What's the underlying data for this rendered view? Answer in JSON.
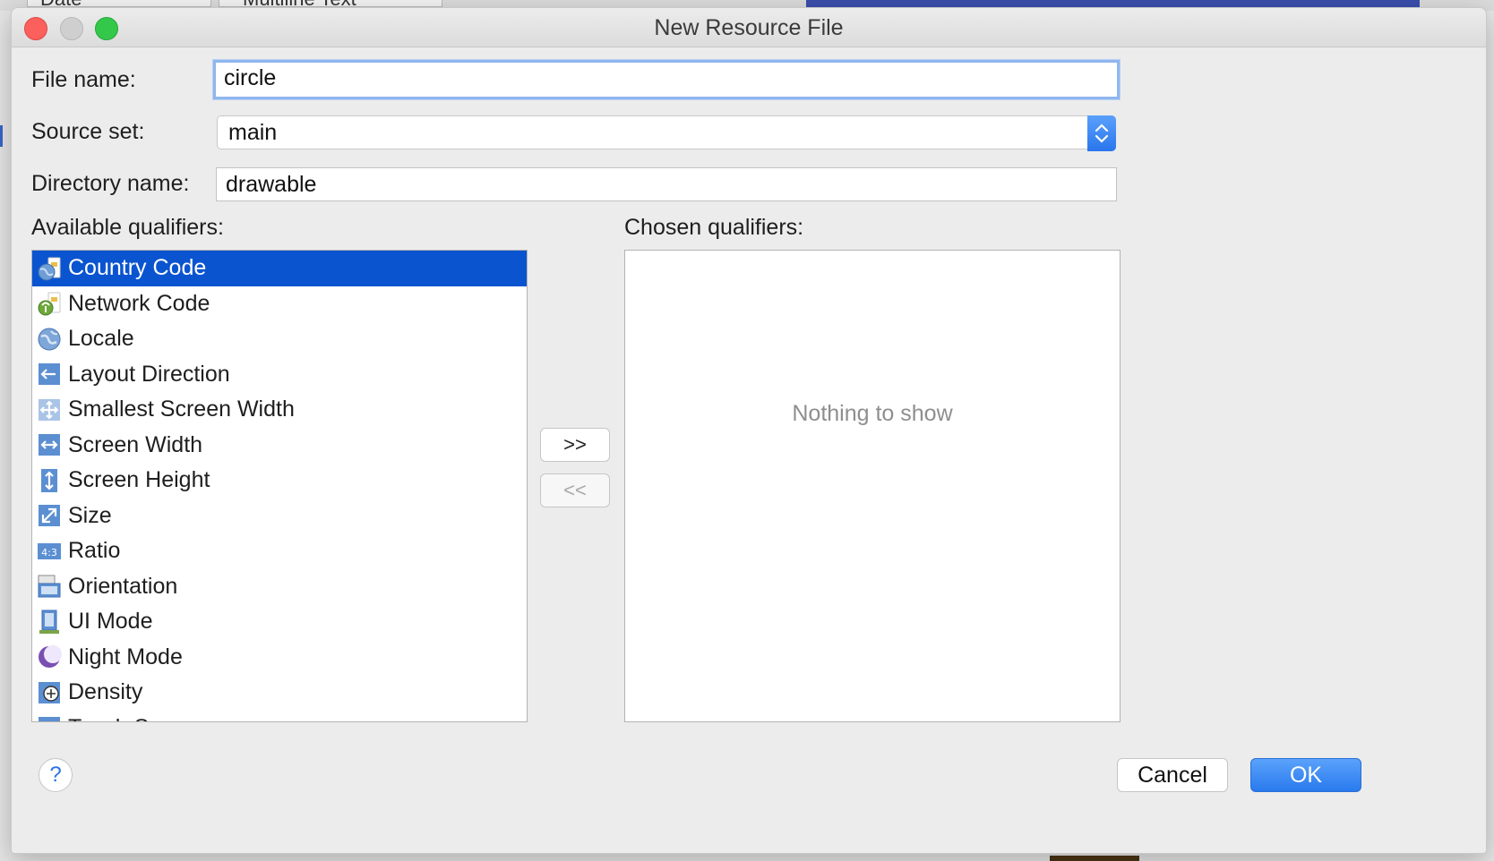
{
  "background": {
    "tab1_label": "Date",
    "tab2_label": "Multiline Text"
  },
  "dialog": {
    "title": "New Resource File"
  },
  "form": {
    "file_name_label": "File name:",
    "file_name_value": "circle",
    "source_set_label": "Source set:",
    "source_set_value": "main",
    "directory_name_label": "Directory name:",
    "directory_name_value": "drawable"
  },
  "qualifiers": {
    "available_label": "Available qualifiers:",
    "chosen_label": "Chosen qualifiers:",
    "available": [
      {
        "label": "Country Code",
        "icon": "globe-sim-icon",
        "selected": true
      },
      {
        "label": "Network Code",
        "icon": "network-antenna-icon",
        "selected": false
      },
      {
        "label": "Locale",
        "icon": "globe-icon",
        "selected": false
      },
      {
        "label": "Layout Direction",
        "icon": "arrow-left-icon",
        "selected": false
      },
      {
        "label": "Smallest Screen Width",
        "icon": "move-arrows-icon",
        "selected": false
      },
      {
        "label": "Screen Width",
        "icon": "horizontal-arrows-icon",
        "selected": false
      },
      {
        "label": "Screen Height",
        "icon": "vertical-arrows-icon",
        "selected": false
      },
      {
        "label": "Size",
        "icon": "diagonal-arrow-icon",
        "selected": false
      },
      {
        "label": "Ratio",
        "icon": "ratio-icon",
        "selected": false
      },
      {
        "label": "Orientation",
        "icon": "orientation-icon",
        "selected": false
      },
      {
        "label": "UI Mode",
        "icon": "device-icon",
        "selected": false
      },
      {
        "label": "Night Mode",
        "icon": "moon-icon",
        "selected": false
      },
      {
        "label": "Density",
        "icon": "density-icon",
        "selected": false
      },
      {
        "label": "Touch Screen",
        "icon": "touch-hand-icon",
        "selected": false
      }
    ],
    "add_button": ">>",
    "remove_button": "<<",
    "chosen_empty_text": "Nothing to show"
  },
  "footer": {
    "help": "?",
    "cancel": "Cancel",
    "ok": "OK"
  },
  "colors": {
    "selection": "#0a54d0",
    "accent": "#2a7aee"
  }
}
